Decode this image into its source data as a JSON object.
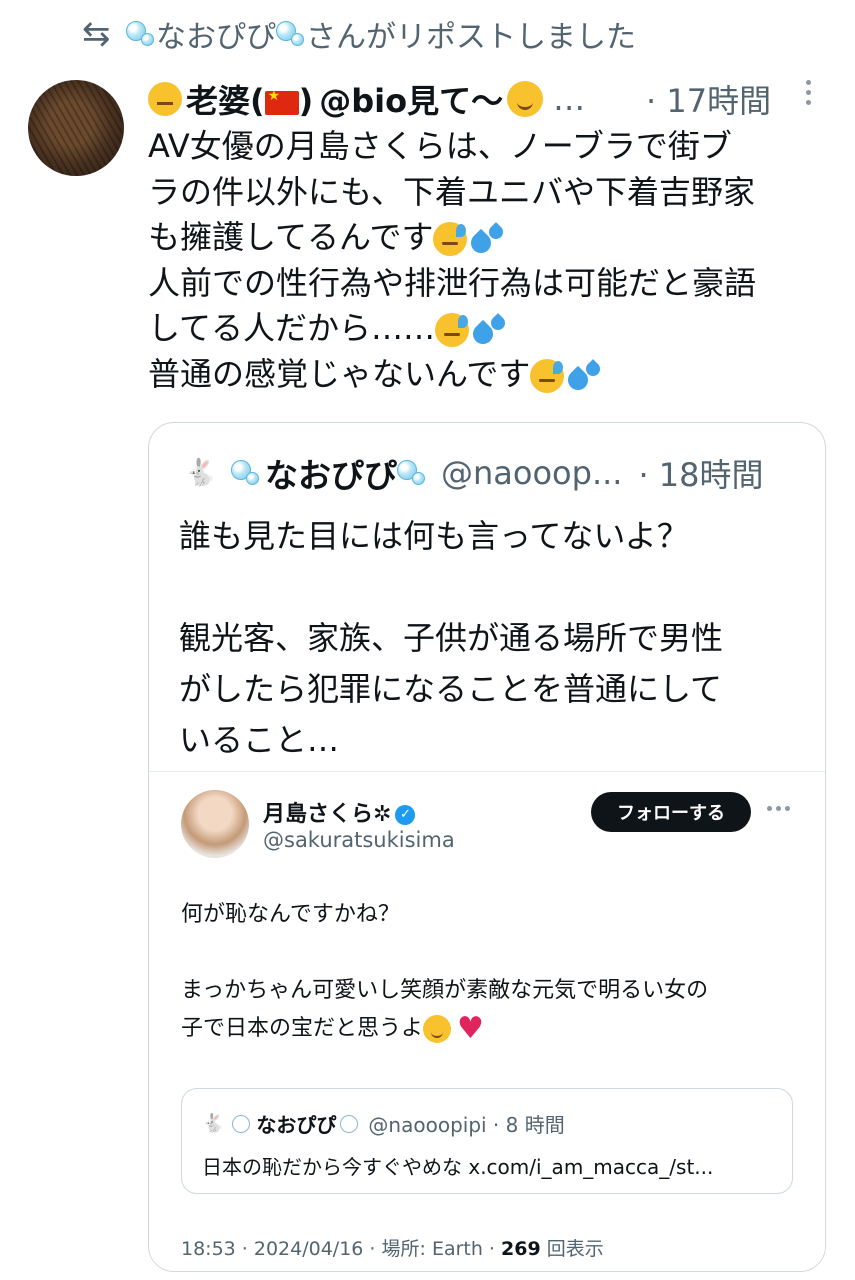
{
  "repost": {
    "icon": "repost-icon",
    "name_text": "なおぴぴ",
    "suffix_text": "さんがリポストしました"
  },
  "tweet": {
    "display_name": "老婆(",
    "display_name_close": ")",
    "handle": "@bio見て〜",
    "ellipsis": "…",
    "time": "· 17時間",
    "lines": [
      "AV女優の月島さくらは、ノーブラで街ブ",
      "ラの件以外にも、下着ユニバや下着吉野家",
      "も擁護してるんです",
      "人前での性行為や排泄行為は可能だと豪語",
      "してる人だから……",
      "普通の感覚じゃないんです"
    ]
  },
  "quote": {
    "display_name": "なおぴぴ",
    "handle": "@naooop...",
    "time": "· 18時間",
    "lines": [
      "誰も見た目には何も言ってないよ？",
      "",
      "観光客、家族、子供が通る場所で男性",
      "がしたら犯罪になることを普通にして",
      "いること…"
    ]
  },
  "screenshot": {
    "display_name": "月島さくら✲",
    "handle": "@sakuratsukisima",
    "follow_label": "フォローする",
    "lines": [
      "何が恥なんですかね？",
      "",
      "まっかちゃん可愛いし笑顔が素敵な元気で明るい女の",
      "子で日本の宝だと思うよ"
    ],
    "inner_quote": {
      "display_name": "なおぴぴ",
      "handle": "@naooopipi · 8 時間",
      "text": "日本の恥だから今すぐやめな x.com/i_am_macca_/st..."
    },
    "meta_time": "18:53 · 2024/04/16 · 場所: Earth · ",
    "meta_views_count": "269",
    "meta_views_label": " 回表示"
  },
  "colors": {
    "text": "#0f1419",
    "secondary": "#536471",
    "border": "#cfd9de",
    "verified": "#1d9bf0",
    "follow_bg": "#0f1419"
  }
}
